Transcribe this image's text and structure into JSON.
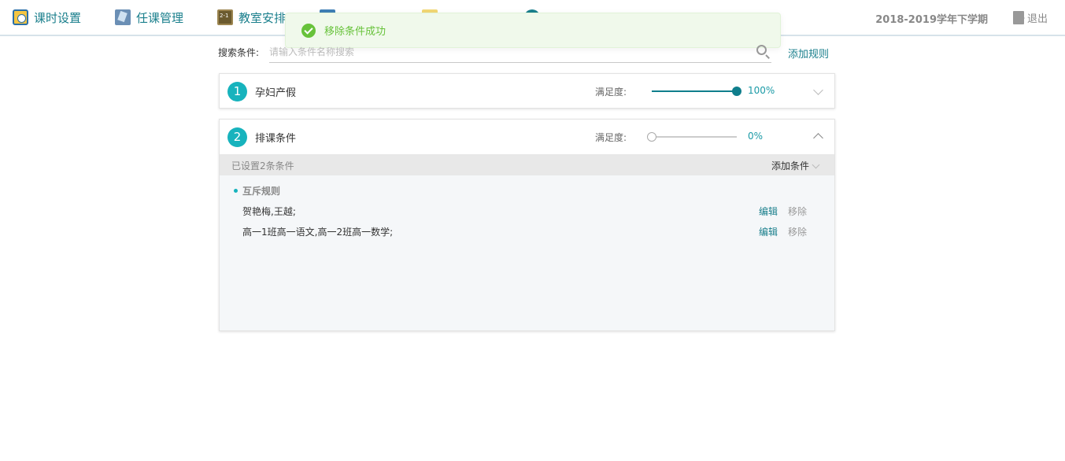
{
  "nav": {
    "items": [
      {
        "label": "课时设置",
        "icon": "clock-settings-icon"
      },
      {
        "label": "任课管理",
        "icon": "teacher-assign-icon"
      },
      {
        "label": "教室安排",
        "icon": "classroom-board-icon"
      },
      {
        "label": "",
        "icon": "schedule-icon"
      },
      {
        "label": "",
        "icon": "note-icon"
      },
      {
        "label": "",
        "icon": "help-icon"
      }
    ],
    "term": "2018-2019学年下学期",
    "logout_label": "退出"
  },
  "toast": {
    "message": "移除条件成功",
    "color": "#67c23a"
  },
  "search": {
    "label": "搜索条件:",
    "placeholder": "请输入条件名称搜索",
    "value": "",
    "add_rule_label": "添加规则"
  },
  "rules": [
    {
      "number": "1",
      "title": "孕妇产假",
      "satisfaction_label": "满足度:",
      "satisfaction_percent": 100,
      "satisfaction_text": "100%",
      "expanded": false
    },
    {
      "number": "2",
      "title": "排课条件",
      "satisfaction_label": "满足度:",
      "satisfaction_percent": 0,
      "satisfaction_text": "0%",
      "expanded": true,
      "conditions_summary": "已设置2条条件",
      "add_condition_label": "添加条件",
      "group_title": "互斥规则",
      "conditions": [
        {
          "text": "贺艳梅,王越;",
          "edit_label": "编辑",
          "remove_label": "移除"
        },
        {
          "text": "高一1班高一语文,高一2班高一数学;",
          "edit_label": "编辑",
          "remove_label": "移除"
        }
      ]
    }
  ],
  "colors": {
    "accent": "#1a7f8c",
    "badge": "#17b3bd",
    "slider": "#0f7e8c"
  }
}
